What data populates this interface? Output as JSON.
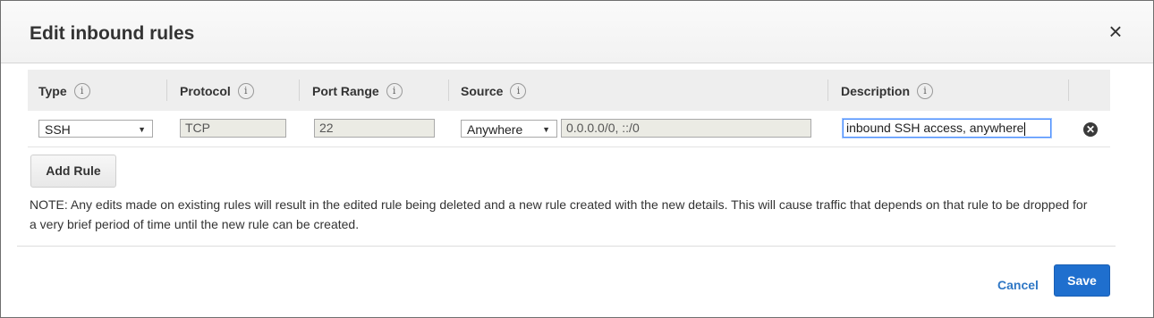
{
  "dialog": {
    "title": "Edit inbound rules",
    "close_icon": "close-icon"
  },
  "table": {
    "columns": [
      {
        "label": "Type",
        "info_icon": "info-icon",
        "info": "i"
      },
      {
        "label": "Protocol",
        "info_icon": "info-icon",
        "info": "i"
      },
      {
        "label": "Port Range",
        "info_icon": "info-icon",
        "info": "i"
      },
      {
        "label": "Source",
        "info_icon": "info-icon",
        "info": "i"
      },
      {
        "label": "Description",
        "info_icon": "info-icon",
        "info": "i"
      }
    ],
    "rows": [
      {
        "type": "SSH",
        "protocol": "TCP",
        "port_range": "22",
        "source_select": "Anywhere",
        "source_value": "0.0.0.0/0, ::/0",
        "description": "inbound SSH access, anywhere",
        "remove_icon": "remove-circle-icon"
      }
    ]
  },
  "actions": {
    "add_rule": "Add Rule",
    "cancel": "Cancel",
    "save": "Save"
  },
  "note": "NOTE: Any edits made on existing rules will result in the edited rule being deleted and a new rule created with the new details. This will cause traffic that depends on that rule to be dropped for a very brief period of time until the new rule can be created.",
  "colors": {
    "primary_button": "#1f6fce",
    "link": "#2f77c5",
    "header_bg": "#f2f2f2",
    "table_header_bg": "#eeeeee",
    "readonly_bg": "#ebebe4"
  }
}
